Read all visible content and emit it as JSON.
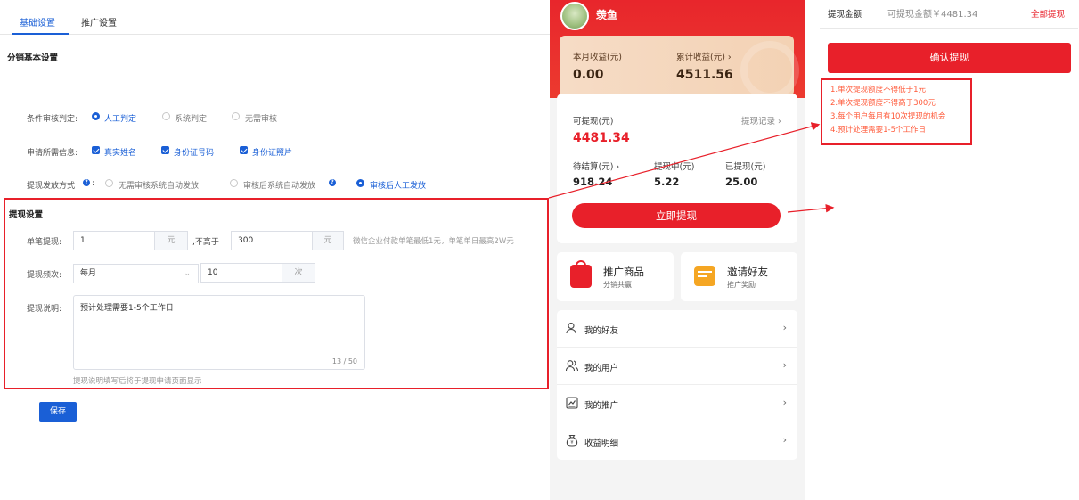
{
  "admin": {
    "tabs": [
      {
        "label": "基础设置",
        "active": true
      },
      {
        "label": "推广设置",
        "active": false
      }
    ],
    "section_title": "分销基本设置",
    "condition": {
      "label": "条件审核判定:",
      "options": [
        "人工判定",
        "系统判定",
        "无需审核"
      ],
      "selected": 0
    },
    "apply_info": {
      "label": "申请所需信息:",
      "options": [
        "真实姓名",
        "身份证号码",
        "身份证照片"
      ]
    },
    "payout": {
      "label": "提现发放方式",
      "options": [
        "无需审核系统自动发放",
        "审核后系统自动发放",
        "审核后人工发放"
      ],
      "selected": 2
    },
    "withdraw": {
      "title": "提现设置",
      "single_label": "单笔提现:",
      "single_min": "1",
      "unit_yuan": "元",
      "not_above": ",不高于",
      "single_max": "300",
      "single_hint": "微信企业付款单笔最低1元，单笔单日最高2W元",
      "freq_label": "提现频次:",
      "freq_period": "每月",
      "freq_count": "10",
      "unit_times": "次",
      "desc_label": "提现说明:",
      "desc_value": "预计处理需要1-5个工作日",
      "desc_counter": "13 / 50",
      "desc_hint": "提现说明填写后将于提现申请页面显示"
    },
    "save_label": "保存"
  },
  "mobile": {
    "user_name": "羡鱼",
    "month_income_label": "本月收益(元)",
    "month_income": "0.00",
    "total_income_label": "累计收益(元) ›",
    "total_income": "4511.56",
    "withdrawable_label": "可提现(元)",
    "withdrawable": "4481.34",
    "records_link": "提现记录 ›",
    "pending_label": "待结算(元) ›",
    "pending": "918.24",
    "processing_label": "提现中(元)",
    "processing": "5.22",
    "withdrawn_label": "已提现(元)",
    "withdrawn": "25.00",
    "withdraw_button": "立即提现",
    "promo_goods_title": "推广商品",
    "promo_goods_sub": "分销共赢",
    "invite_title": "邀请好友",
    "invite_sub": "推广奖励",
    "menu": [
      {
        "label": "我的好友",
        "icon": "user-icon"
      },
      {
        "label": "我的用户",
        "icon": "users-icon"
      },
      {
        "label": "我的推广",
        "icon": "chart-icon"
      },
      {
        "label": "收益明细",
        "icon": "money-bag-icon"
      }
    ]
  },
  "withdraw_page": {
    "amount_label": "提现金额",
    "available_text": "可提现金额￥4481.34",
    "withdraw_all": "全部提现",
    "confirm_button": "确认提现",
    "rules": [
      "1.单次提现额度不得低于1元",
      "2.单次提现额度不得高于300元",
      "3.每个用户每月有10次提现的机会",
      "4.预计处理需要1-5个工作日"
    ]
  },
  "colors": {
    "accent_blue": "#1a5fd6",
    "brand_red": "#e8202a",
    "gold": "#f5d8bd"
  }
}
